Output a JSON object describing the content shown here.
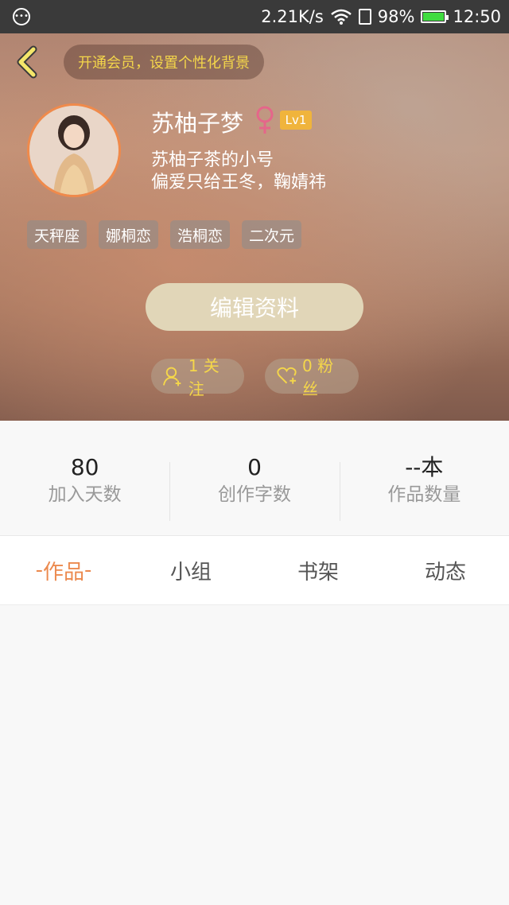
{
  "status_bar": {
    "speed": "2.21K/s",
    "battery": "98%",
    "time": "12:50"
  },
  "header": {
    "vip_banner": "开通会员，设置个性化背景",
    "nickname": "苏柚子梦",
    "level": "Lv1",
    "bio_lines": [
      "苏柚子茶的小号",
      "偏爱只给王冬，鞠婧祎"
    ],
    "tags": [
      "天秤座",
      "娜桐恋",
      "浩桐恋",
      "二次元"
    ],
    "edit_button": "编辑资料",
    "follow": "1 关注",
    "fans": "0 粉丝",
    "colors": {
      "accent": "#f4d64a",
      "avatar_border": "#f08a4b",
      "level_badge": "#f0b43c",
      "female_icon": "#e5668a"
    }
  },
  "stats": [
    {
      "value": "80",
      "label": "加入天数"
    },
    {
      "value": "0",
      "label": "创作字数"
    },
    {
      "value": "--本",
      "label": "作品数量"
    }
  ],
  "tabs": [
    {
      "label": "作品",
      "active": true
    },
    {
      "label": "小组",
      "active": false
    },
    {
      "label": "书架",
      "active": false
    },
    {
      "label": "动态",
      "active": false
    }
  ],
  "icons": [
    "message-dot-icon",
    "wifi-icon",
    "sim-icon",
    "battery-icon",
    "back-icon",
    "female-icon",
    "user-plus-icon",
    "heart-plus-icon"
  ]
}
